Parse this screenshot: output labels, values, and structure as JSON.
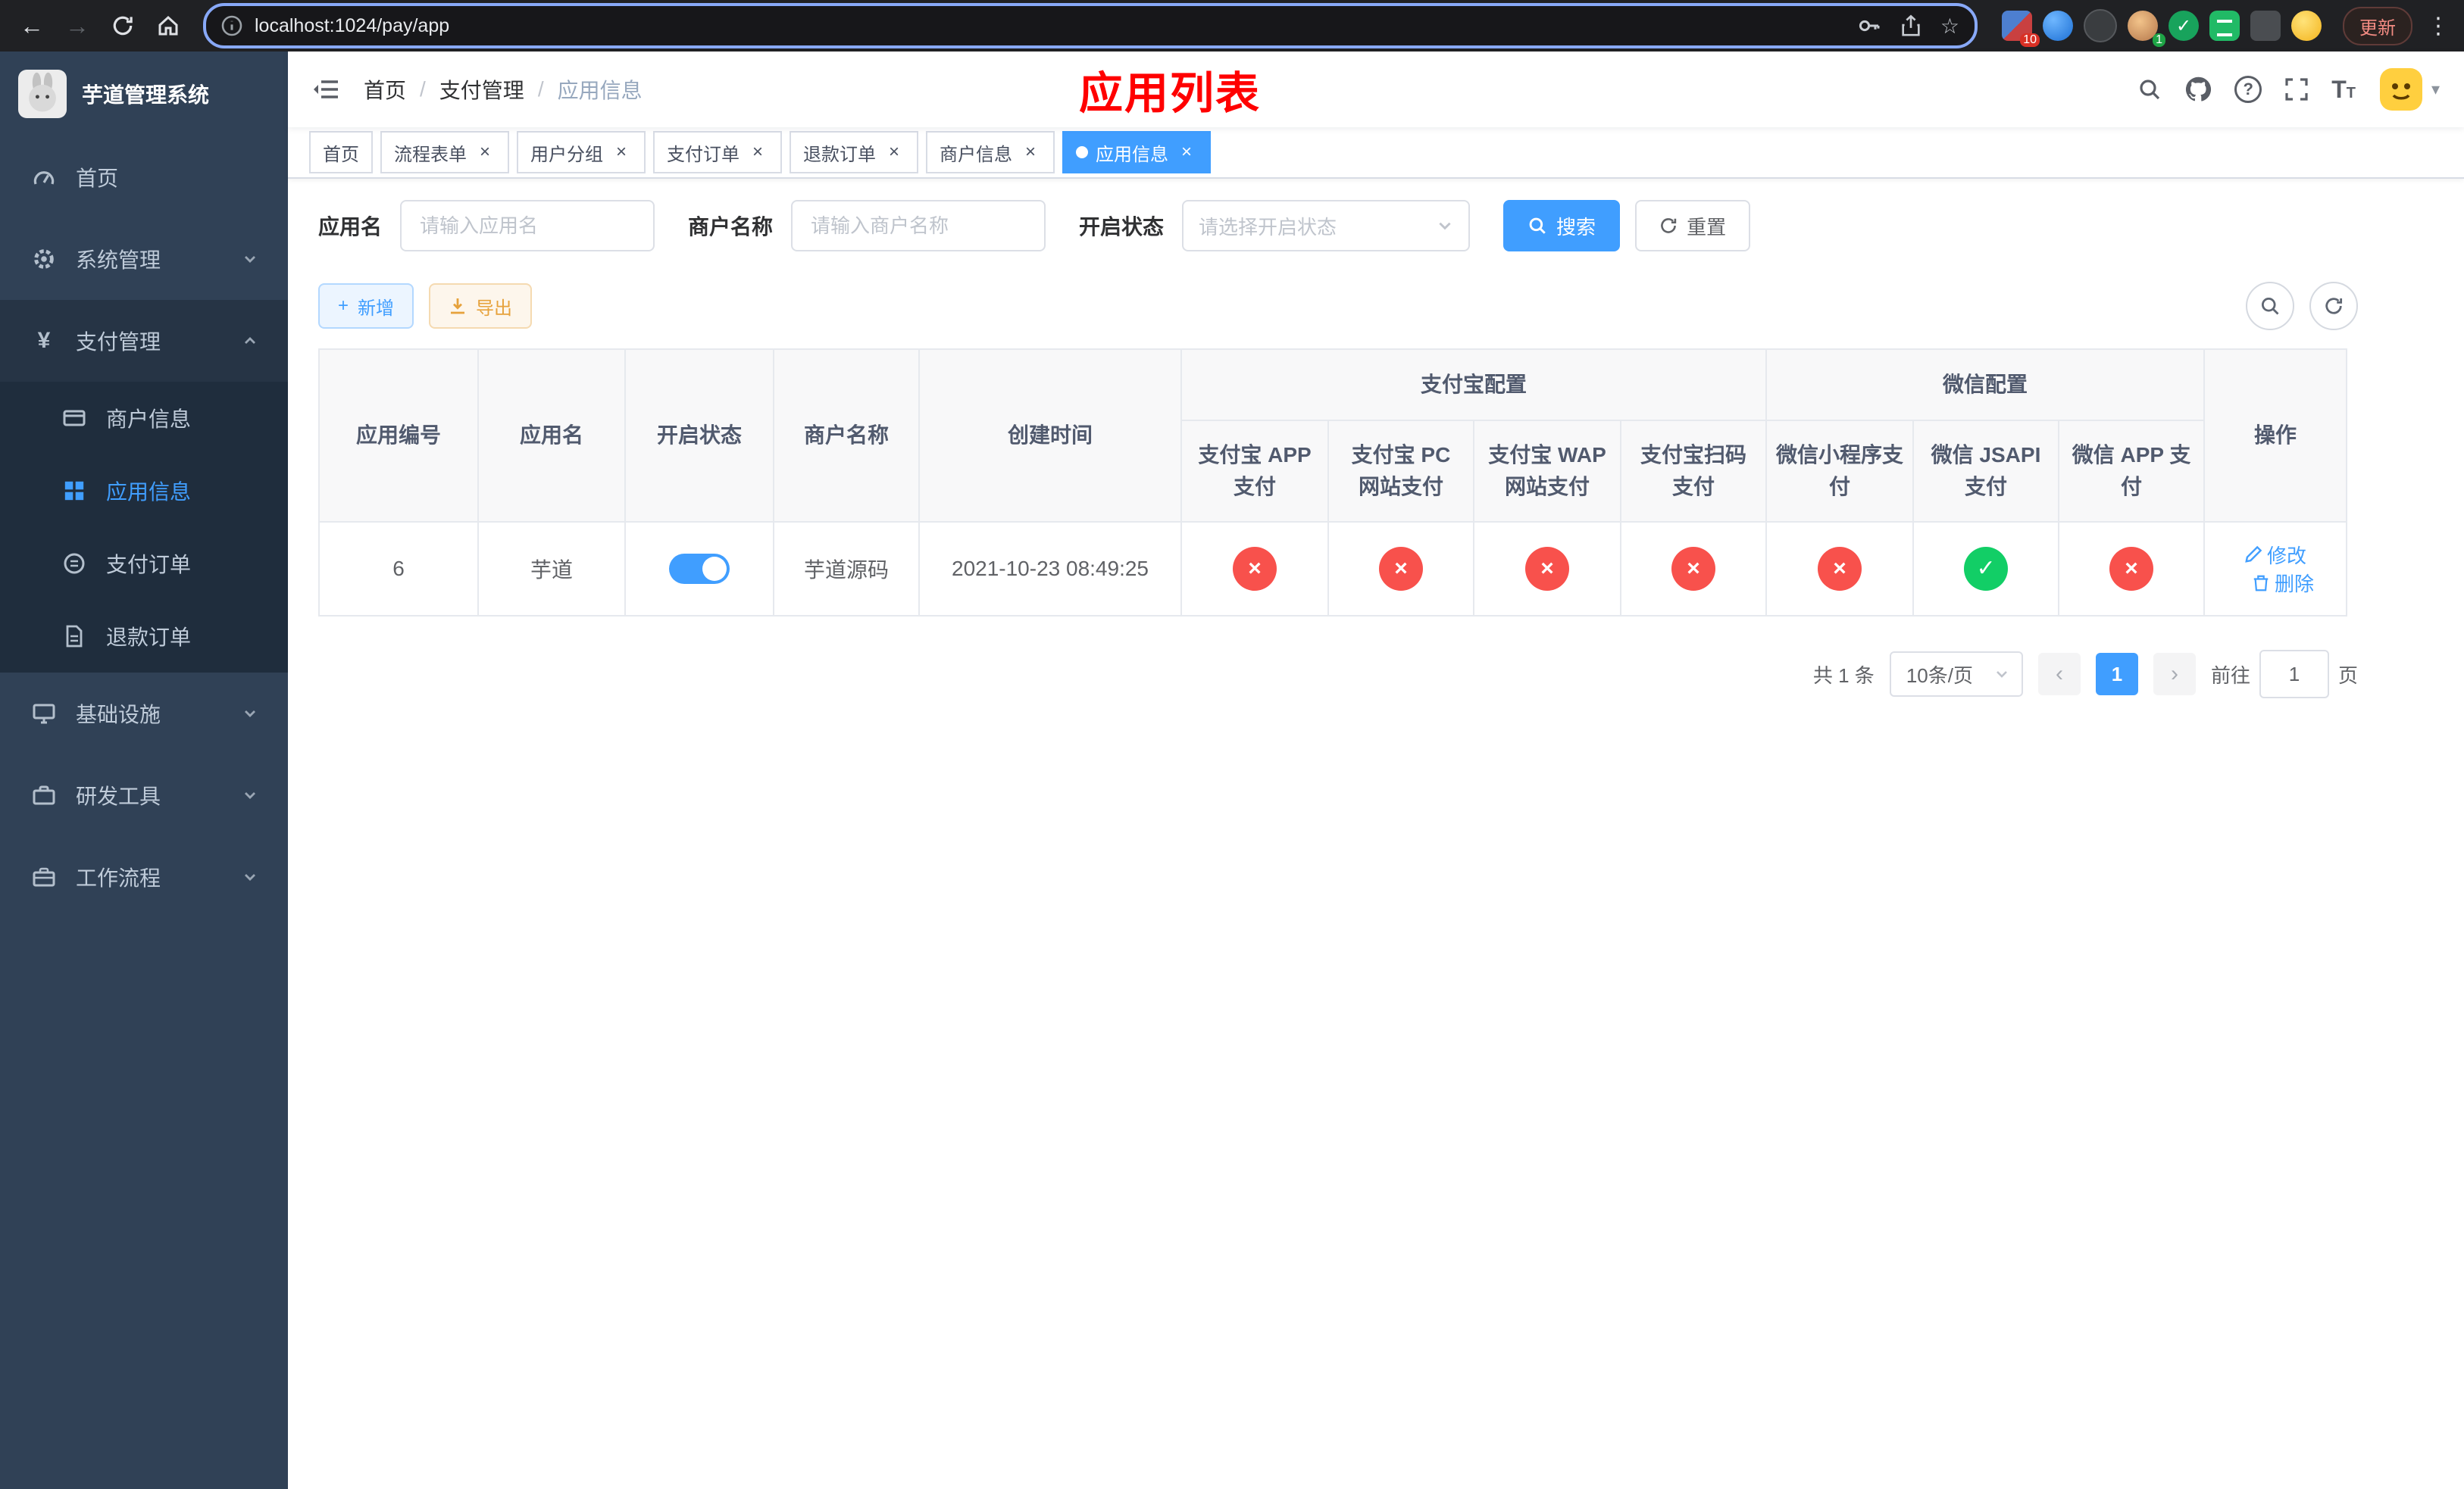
{
  "icons": {
    "close": "×",
    "check": "✓",
    "cross": "×",
    "plus": "+",
    "caret_down": "▾",
    "prev": "‹",
    "next": "›",
    "menu_dots": "⋮",
    "back": "←",
    "forward": "→",
    "star": "☆",
    "yen": "¥",
    "question": "?",
    "font_size": "T"
  },
  "browser": {
    "url": "localhost:1024/pay/app",
    "update_label": "更新",
    "ext_badge_count": "10",
    "profile_badge_count": "1"
  },
  "sidebar": {
    "title": "芋道管理系统",
    "menu": [
      {
        "label": "首页"
      },
      {
        "label": "系统管理"
      },
      {
        "label": "支付管理"
      },
      {
        "label": "基础设施"
      },
      {
        "label": "研发工具"
      },
      {
        "label": "工作流程"
      }
    ],
    "payment_submenu": [
      {
        "label": "商户信息"
      },
      {
        "label": "应用信息"
      },
      {
        "label": "支付订单"
      },
      {
        "label": "退款订单"
      }
    ]
  },
  "header": {
    "breadcrumb": [
      {
        "label": "首页"
      },
      {
        "label": "支付管理"
      },
      {
        "label": "应用信息"
      }
    ],
    "annotation": "应用列表"
  },
  "tabs": [
    {
      "label": "首页"
    },
    {
      "label": "流程表单"
    },
    {
      "label": "用户分组"
    },
    {
      "label": "支付订单"
    },
    {
      "label": "退款订单"
    },
    {
      "label": "商户信息"
    },
    {
      "label": "应用信息"
    }
  ],
  "filters": {
    "app_name": {
      "label": "应用名",
      "placeholder": "请输入应用名",
      "value": ""
    },
    "merchant_name": {
      "label": "商户名称",
      "placeholder": "请输入商户名称",
      "value": ""
    },
    "status": {
      "label": "开启状态",
      "placeholder": "请选择开启状态"
    },
    "search_label": "搜索",
    "reset_label": "重置"
  },
  "toolbar": {
    "add_label": "新增",
    "export_label": "导出"
  },
  "table": {
    "headers": {
      "app_id": "应用编号",
      "app_name": "应用名",
      "status": "开启状态",
      "merchant_name": "商户名称",
      "create_time": "创建时间",
      "alipay_group": "支付宝配置",
      "wechat_group": "微信配置",
      "alipay_app": "支付宝 APP 支付",
      "alipay_pc": "支付宝 PC 网站支付",
      "alipay_wap": "支付宝 WAP 网站支付",
      "alipay_qr": "支付宝扫码支付",
      "wechat_lite": "微信小程序支付",
      "wechat_jsapi": "微信 JSAPI 支付",
      "wechat_app": "微信 APP 支付",
      "ops": "操作"
    },
    "rows": [
      {
        "app_id": "6",
        "app_name": "芋道",
        "status_on": true,
        "merchant_name": "芋道源码",
        "create_time": "2021-10-23 08:49:25",
        "configs": [
          false,
          false,
          false,
          false,
          false,
          true,
          false
        ],
        "edit_label": "修改",
        "delete_label": "删除"
      }
    ]
  },
  "pagination": {
    "total_text": "共 1 条",
    "page_size_text": "10条/页",
    "current_page": "1",
    "goto_prefix": "前往",
    "goto_value": "1",
    "goto_suffix": "页"
  }
}
